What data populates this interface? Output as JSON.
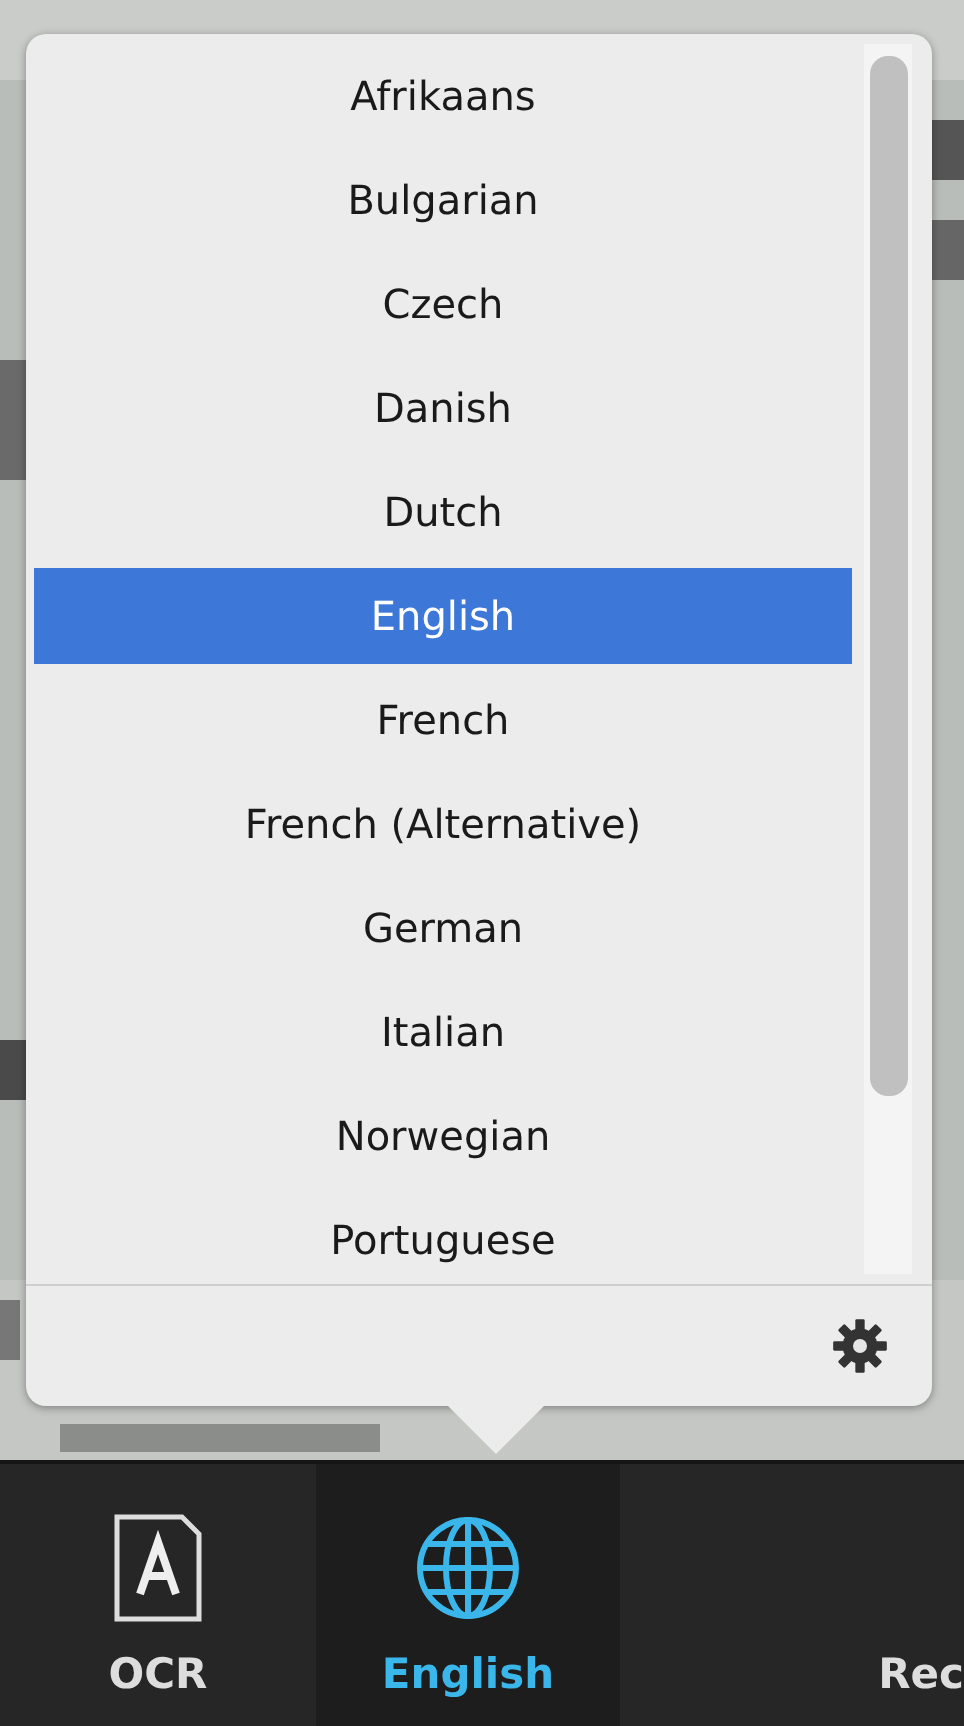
{
  "languages": [
    {
      "label": "Afrikaans",
      "selected": false
    },
    {
      "label": "Bulgarian",
      "selected": false
    },
    {
      "label": "Czech",
      "selected": false
    },
    {
      "label": "Danish",
      "selected": false
    },
    {
      "label": "Dutch",
      "selected": false
    },
    {
      "label": "English",
      "selected": true
    },
    {
      "label": "French",
      "selected": false
    },
    {
      "label": "French (Alternative)",
      "selected": false
    },
    {
      "label": "German",
      "selected": false
    },
    {
      "label": "Italian",
      "selected": false
    },
    {
      "label": "Norwegian",
      "selected": false
    },
    {
      "label": "Portuguese",
      "selected": false
    }
  ],
  "toolbar": [
    {
      "label": "OCR",
      "kind": "document",
      "selected": false
    },
    {
      "label": "English",
      "kind": "globe",
      "selected": true
    },
    {
      "label": "Rec",
      "kind": "cut",
      "selected": false
    }
  ]
}
